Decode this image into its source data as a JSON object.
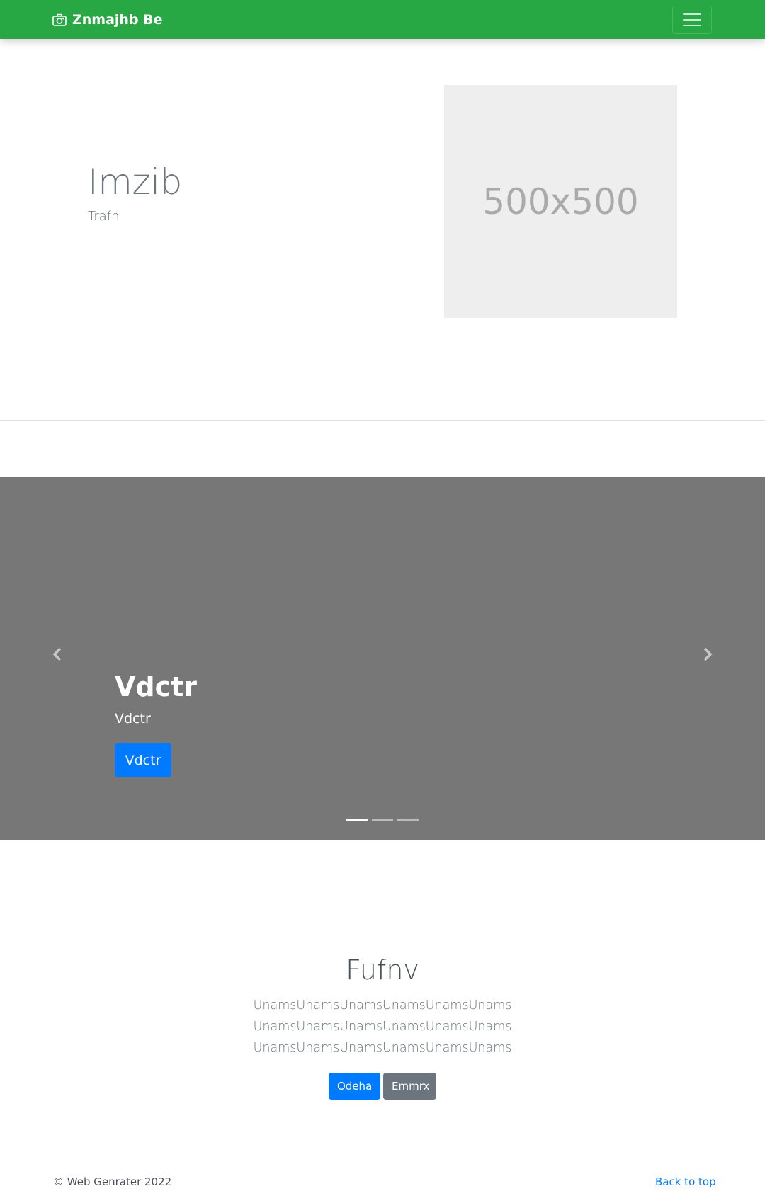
{
  "navbar": {
    "brand": "Znmajhb Be",
    "brand_icon": "camera-icon",
    "toggler_icon": "hamburger-menu-icon",
    "color": "#28a745"
  },
  "hero": {
    "title": "Imzib",
    "subtitle": "Trafh",
    "placeholder_text": "500x500"
  },
  "carousel": {
    "background": "#777777",
    "prev_icon": "chevron-left-icon",
    "next_icon": "chevron-right-icon",
    "caption_title": "Vdctr",
    "caption_text": "Vdctr",
    "caption_button": "Vdctr",
    "indicators": 3,
    "active_indicator": 1
  },
  "section": {
    "title": "Fufnv",
    "lines": [
      "UnamsUnamsUnamsUnamsUnamsUnams",
      "UnamsUnamsUnamsUnamsUnamsUnams",
      "UnamsUnamsUnamsUnamsUnamsUnams"
    ],
    "primary_button": "Odeha",
    "secondary_button": "Emmrx"
  },
  "footer": {
    "copyright": "© Web Genrater 2022",
    "back_to_top": "Back to top"
  }
}
